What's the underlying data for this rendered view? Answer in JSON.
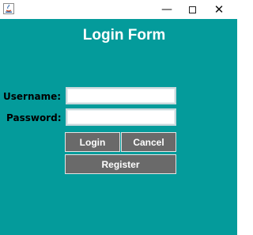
{
  "window": {
    "controls": {
      "minimize_glyph": "—",
      "close_glyph": "✕"
    }
  },
  "form": {
    "title": "Login Form",
    "username_label": "Username:",
    "username_value": "",
    "password_label": "Password:",
    "password_value": "",
    "login_label": "Login",
    "cancel_label": "Cancel",
    "register_label": "Register"
  },
  "colors": {
    "background": "#049b9b",
    "button": "#6a6a6a",
    "title_text": "#ffffff"
  },
  "icons": [
    "java-app-icon",
    "minimize-icon",
    "maximize-icon",
    "close-icon"
  ]
}
